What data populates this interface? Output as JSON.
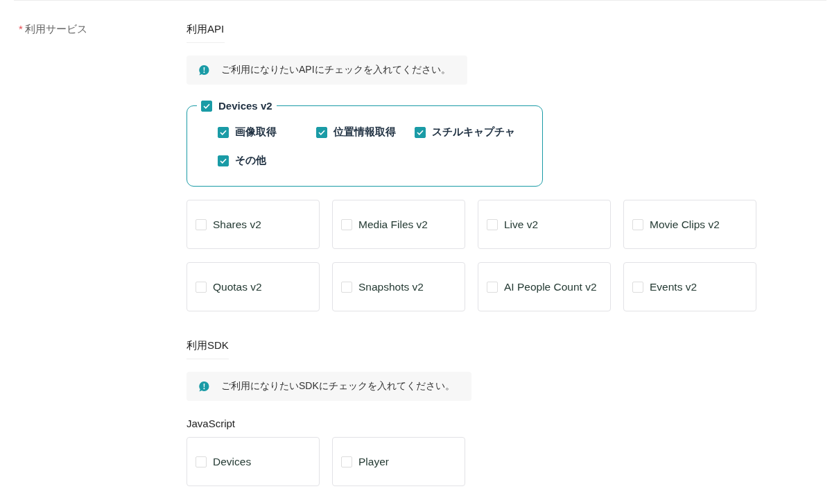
{
  "field": {
    "label": "利用サービス",
    "required": true,
    "required_mark": "*"
  },
  "api": {
    "heading": "利用API",
    "hint": "ご利用になりたいAPIにチェックを入れてください。",
    "group": {
      "label": "Devices v2",
      "checked": true,
      "children": [
        {
          "label": "画像取得",
          "checked": true
        },
        {
          "label": "位置情報取得",
          "checked": true
        },
        {
          "label": "スチルキャプチャ",
          "checked": true
        },
        {
          "label": "その他",
          "checked": true
        }
      ]
    },
    "options": [
      {
        "label": "Shares v2",
        "checked": false
      },
      {
        "label": "Media Files v2",
        "checked": false
      },
      {
        "label": "Live v2",
        "checked": false
      },
      {
        "label": "Movie Clips v2",
        "checked": false
      },
      {
        "label": "Quotas v2",
        "checked": false
      },
      {
        "label": "Snapshots v2",
        "checked": false
      },
      {
        "label": "AI People Count v2",
        "checked": false
      },
      {
        "label": "Events v2",
        "checked": false
      }
    ]
  },
  "sdk": {
    "heading": "利用SDK",
    "hint": "ご利用になりたいSDKにチェックを入れてください。",
    "sections": [
      {
        "title": "JavaScript",
        "options": [
          {
            "label": "Devices",
            "checked": false
          },
          {
            "label": "Player",
            "checked": false
          }
        ]
      }
    ]
  }
}
